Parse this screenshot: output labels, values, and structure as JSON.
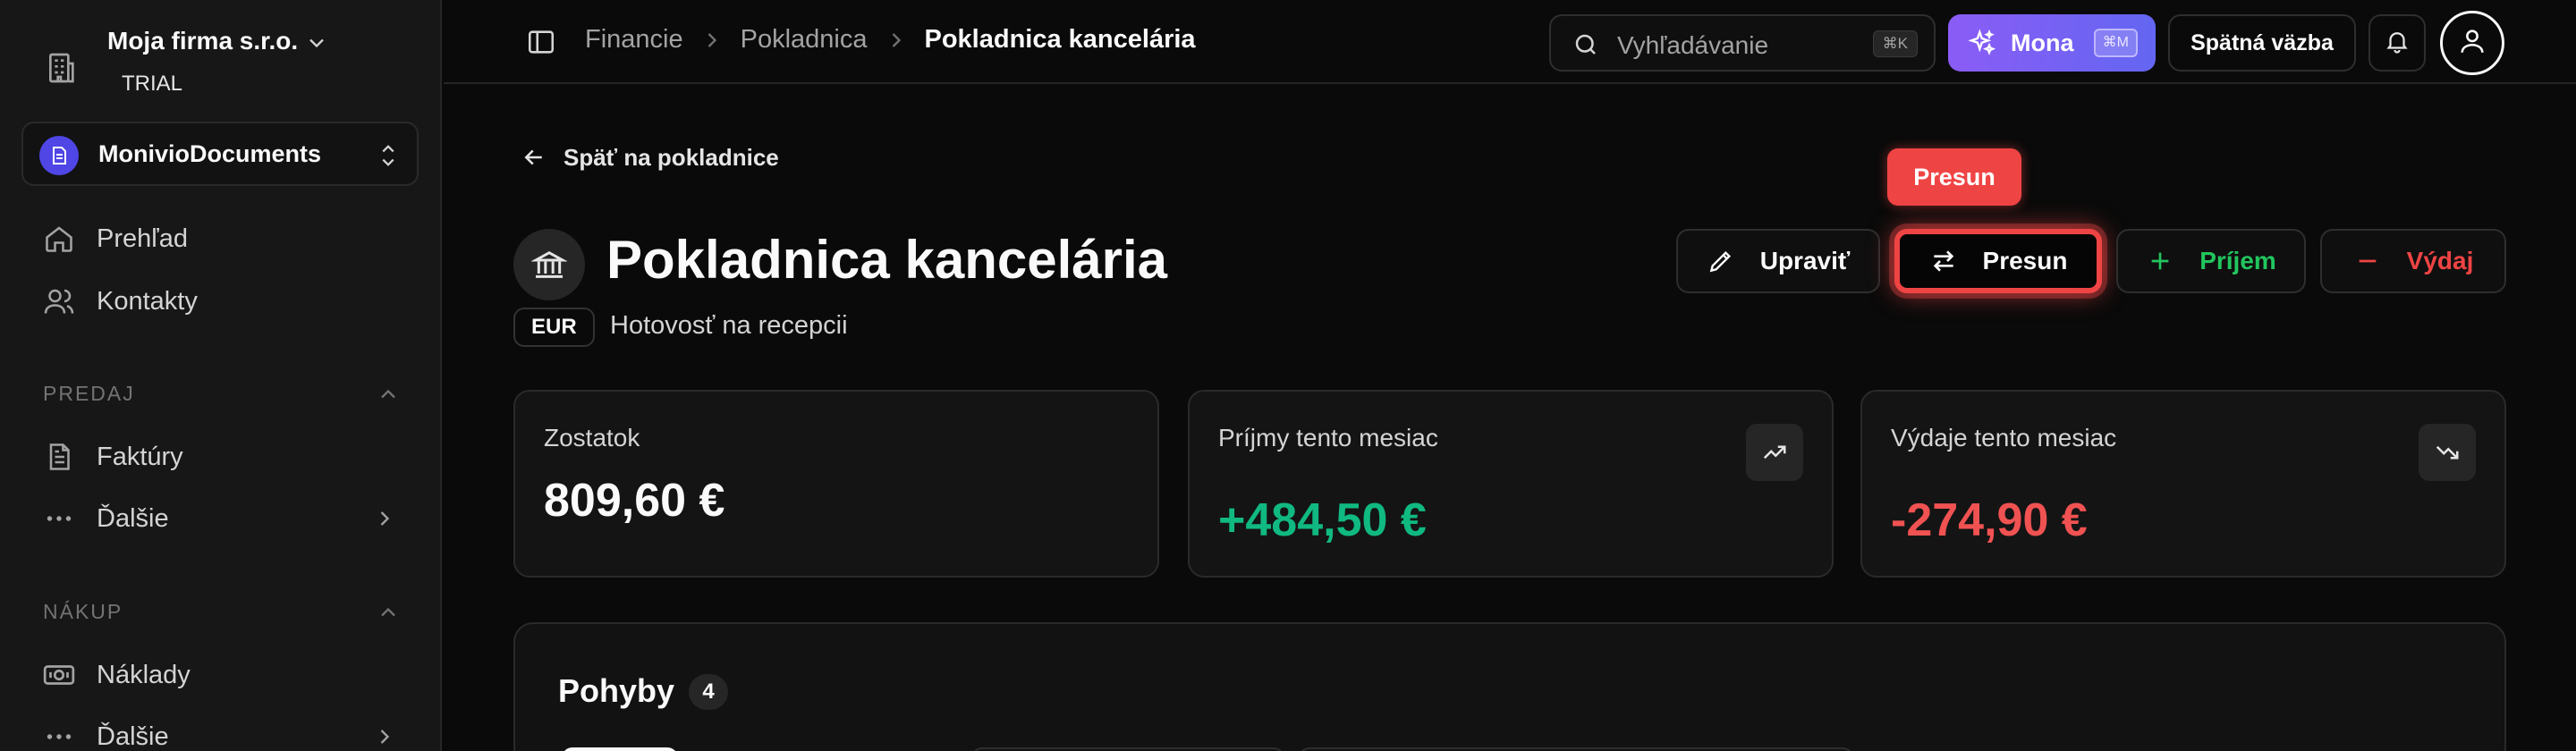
{
  "sidebar": {
    "org_name": "Moja firma s.r.o.",
    "org_plan": "TRIAL",
    "workspace": "MonivioDocuments",
    "items": [
      {
        "label": "Prehľad",
        "icon": "home-icon"
      },
      {
        "label": "Kontakty",
        "icon": "users-icon"
      }
    ],
    "sections": [
      {
        "title": "PREDAJ",
        "items": [
          {
            "label": "Faktúry",
            "icon": "document-icon"
          },
          {
            "label": "Ďalšie",
            "icon": "more-icon"
          }
        ]
      },
      {
        "title": "NÁKUP",
        "items": [
          {
            "label": "Náklady",
            "icon": "money-icon"
          },
          {
            "label": "Ďalšie",
            "icon": "more-icon"
          }
        ]
      }
    ]
  },
  "topbar": {
    "breadcrumbs": [
      "Financie",
      "Pokladnica",
      "Pokladnica kancelária"
    ],
    "search_placeholder": "Vyhľadávanie",
    "search_shortcut": "⌘K",
    "mona_label": "Mona",
    "mona_shortcut": "⌘M",
    "feedback_label": "Spätná väzba"
  },
  "main": {
    "back_label": "Späť na pokladnice",
    "tooltip": "Presun",
    "title": "Pokladnica kancelária",
    "currency": "EUR",
    "subtitle": "Hotovosť na recepcii",
    "actions": {
      "edit": "Upraviť",
      "move": "Presun",
      "income": "Príjem",
      "expense": "Výdaj"
    },
    "cards": [
      {
        "label": "Zostatok",
        "value": "809,60 €",
        "color": "#fafafa"
      },
      {
        "label": "Príjmy tento mesiac",
        "value": "+484,50 €",
        "color": "#10b981",
        "icon": "trending-up-icon"
      },
      {
        "label": "Výdaje tento mesiac",
        "value": "-274,90 €",
        "color": "#f05252",
        "icon": "trending-down-icon"
      }
    ],
    "movements": {
      "title": "Pohyby",
      "count": "4"
    }
  },
  "colors": {
    "accent_red": "#ef4444",
    "income_green": "#22c55e",
    "mona_purple": "#8b5cf6"
  }
}
